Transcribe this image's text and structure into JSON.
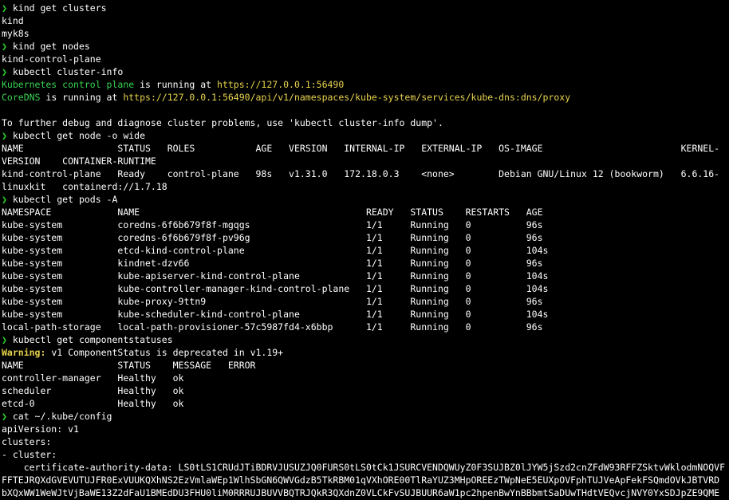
{
  "prompt_symbol": "❯",
  "lines": [
    {
      "type": "cmd",
      "text": "kind get clusters"
    },
    {
      "type": "out",
      "text": "kind"
    },
    {
      "type": "out",
      "text": "myk8s"
    },
    {
      "type": "cmd",
      "text": "kind get nodes"
    },
    {
      "type": "out",
      "text": "kind-control-plane"
    },
    {
      "type": "cmd",
      "text": "kubectl cluster-info"
    },
    {
      "type": "info1",
      "a": "Kubernetes control plane",
      "b": " is running at ",
      "c": "https://127.0.0.1:56490"
    },
    {
      "type": "info1",
      "a": "CoreDNS",
      "b": " is running at ",
      "c": "https://127.0.0.1:56490/api/v1/namespaces/kube-system/services/kube-dns:dns/proxy"
    },
    {
      "type": "blank",
      "text": ""
    },
    {
      "type": "out",
      "text": "To further debug and diagnose cluster problems, use 'kubectl cluster-info dump'."
    },
    {
      "type": "cmd",
      "text": "kubectl get node -o wide"
    },
    {
      "type": "out",
      "text": "NAME                 STATUS   ROLES           AGE   VERSION   INTERNAL-IP   EXTERNAL-IP   OS-IMAGE                         KERNEL-"
    },
    {
      "type": "out",
      "text": "VERSION    CONTAINER-RUNTIME"
    },
    {
      "type": "out",
      "text": "kind-control-plane   Ready    control-plane   98s   v1.31.0   172.18.0.3    <none>        Debian GNU/Linux 12 (bookworm)   6.6.16-"
    },
    {
      "type": "out",
      "text": "linuxkit   containerd://1.7.18"
    },
    {
      "type": "cmd",
      "text": "kubectl get pods -A"
    },
    {
      "type": "out",
      "text": "NAMESPACE            NAME                                         READY   STATUS    RESTARTS   AGE"
    },
    {
      "type": "out",
      "text": "kube-system          coredns-6f6b679f8f-mgqgs                     1/1     Running   0          96s"
    },
    {
      "type": "out",
      "text": "kube-system          coredns-6f6b679f8f-pv96g                     1/1     Running   0          96s"
    },
    {
      "type": "out",
      "text": "kube-system          etcd-kind-control-plane                      1/1     Running   0          104s"
    },
    {
      "type": "out",
      "text": "kube-system          kindnet-dzv66                                1/1     Running   0          96s"
    },
    {
      "type": "out",
      "text": "kube-system          kube-apiserver-kind-control-plane            1/1     Running   0          104s"
    },
    {
      "type": "out",
      "text": "kube-system          kube-controller-manager-kind-control-plane   1/1     Running   0          104s"
    },
    {
      "type": "out",
      "text": "kube-system          kube-proxy-9ttn9                             1/1     Running   0          96s"
    },
    {
      "type": "out",
      "text": "kube-system          kube-scheduler-kind-control-plane            1/1     Running   0          104s"
    },
    {
      "type": "out",
      "text": "local-path-storage   local-path-provisioner-57c5987fd4-x6bbp      1/1     Running   0          96s"
    },
    {
      "type": "cmd",
      "text": "kubectl get componentstatuses"
    },
    {
      "type": "warn",
      "a": "Warning:",
      "b": " v1 ComponentStatus is deprecated in v1.19+"
    },
    {
      "type": "out",
      "text": "NAME                 STATUS    MESSAGE   ERROR"
    },
    {
      "type": "out",
      "text": "controller-manager   Healthy   ok"
    },
    {
      "type": "out",
      "text": "scheduler            Healthy   ok"
    },
    {
      "type": "out",
      "text": "etcd-0               Healthy   ok"
    },
    {
      "type": "cmd",
      "text": "cat ~/.kube/config"
    },
    {
      "type": "out",
      "text": "apiVersion: v1"
    },
    {
      "type": "out",
      "text": "clusters:"
    },
    {
      "type": "out",
      "text": "- cluster:"
    },
    {
      "type": "out",
      "text": "    certificate-authority-data: LS0tLS1CRUdJTiBDRVJUSUZJQ0FURS0tLS0tCk1JSURCVENDQWUyZ0F3SUJBZ0lJYW5jSzd2cnZFdW93RFFZSktvWklodmNOQVF"
    },
    {
      "type": "out",
      "text": "FFTEJRQXdGVEVUTUJFR0ExVUUKQXhNS2EzVmlaWEp1WlhSbGN6QWVGdzB5TkRBM01qVXhORE00TlRaYUZ3MHpOREEzTWpNeE5EUXpOVFphTUJVeApFekFSQmdOVkJBTVRD"
    },
    {
      "type": "out",
      "text": "bXQxWW1WeWJtVjBaWE13Z2dFaU1BMEdDU3FHU0liM0RRRUJBUVVBQTRJQkR3QXdnZ0VLCkFvSUJBUUR6aW1pc2hpenBwYnBBbmtSaDUwTHdtVEQvcjNVY0YxSDJpZE9QME"
    }
  ]
}
